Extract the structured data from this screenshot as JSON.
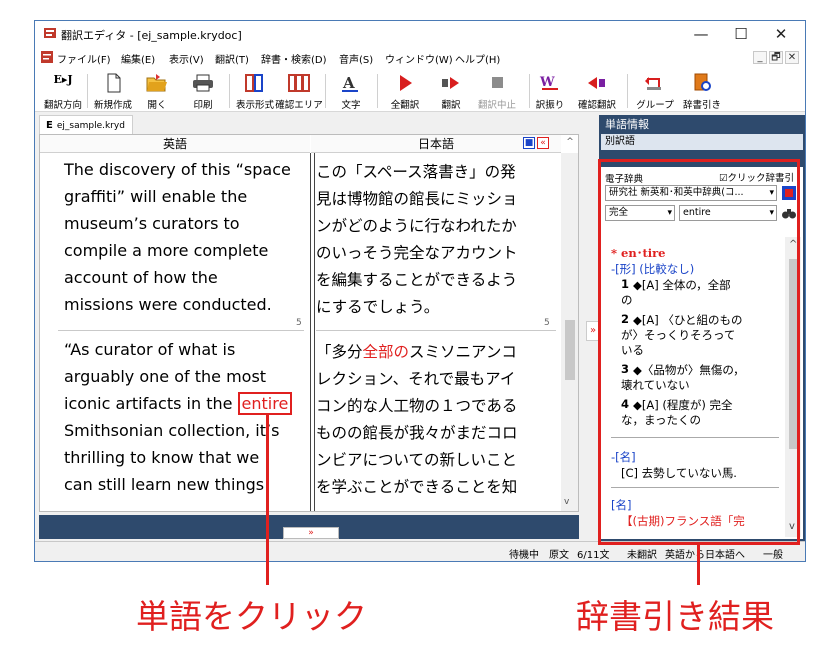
{
  "window": {
    "title": "翻訳エディタ - [ej_sample.krydoc]",
    "controls": {
      "minimize": "—",
      "maximize": "☐",
      "close": "✕"
    }
  },
  "menubar": {
    "items": [
      "ファイル(F)",
      "編集(E)",
      "表示(V)",
      "翻訳(T)",
      "辞書・検索(D)",
      "音声(S)",
      "ウィンドウ(W)",
      "ヘルプ(H)"
    ],
    "mdi": [
      "_",
      "🗗",
      "✕"
    ]
  },
  "toolbar": {
    "items": [
      {
        "label": "翻訳方向",
        "icon": "translation-direction-icon"
      },
      {
        "label": "新規作成",
        "icon": "new-document-icon"
      },
      {
        "label": "開く",
        "icon": "open-folder-icon"
      },
      {
        "label": "印刷",
        "icon": "printer-icon"
      },
      {
        "label": "表示形式",
        "icon": "display-format-icon"
      },
      {
        "label": "確認エリア",
        "icon": "check-area-icon"
      },
      {
        "label": "文字",
        "icon": "font-icon"
      },
      {
        "label": "全翻訳",
        "icon": "translate-all-icon"
      },
      {
        "label": "翻訳",
        "icon": "translate-icon"
      },
      {
        "label": "翻訳中止",
        "icon": "stop-icon"
      },
      {
        "label": "訳振り",
        "icon": "annotate-icon"
      },
      {
        "label": "確認翻訳",
        "icon": "back-translate-icon"
      },
      {
        "label": "グループ",
        "icon": "group-icon"
      },
      {
        "label": "辞書引き",
        "icon": "dictionary-lookup-icon"
      }
    ],
    "direction_text": "E▸J"
  },
  "doc_tab": {
    "prefix": "E",
    "name": "ej_sample.kryd"
  },
  "editor": {
    "header_english": "英語",
    "header_japanese": "日本語",
    "paragraphs": [
      {
        "number": "5",
        "english": [
          "The discovery of this “space",
          "graffiti” will enable the",
          "museum’s curators to",
          "compile a more complete",
          "account of how the",
          "missions were conducted."
        ],
        "japanese": [
          "この「スペース落書き」の発",
          "見は博物館の館長にミッショ",
          "ンがどのように行なわれたか",
          "のいっそう完全なアカウント",
          "を編集することができるよう",
          "にするでしょう。"
        ]
      },
      {
        "number": "5",
        "english": [
          "“As curator of what is",
          "arguably one of the most",
          "iconic artifacts in the ",
          "Smithsonian collection, it’s",
          "thrilling to know that we",
          "can still learn new things"
        ],
        "english_highlight": "entire",
        "japanese": [
          "「多分",
          "レクション、それで最もアイ",
          "コン的な人工物の１つである",
          "ものの館長が我々がまだコロ",
          "ンビアについての新しいこと",
          "を学ぶことができることを知"
        ],
        "japanese_highlight": "全部の",
        "japanese_first_tail": "スミソニアンコ"
      }
    ]
  },
  "statusbar": {
    "state": "待機中",
    "view": "原文",
    "position": "6/11文",
    "translated": "未翻訳",
    "direction": "英語から日本語へ",
    "mode": "一般"
  },
  "right_panel": {
    "title": "単語情報",
    "subtitle": "別訳語",
    "dictionary": {
      "title": "電子辞典",
      "click_lookup_label": "☑クリック辞書引",
      "dictionary_select": "研究社 新英和･和英中辞典(コ...",
      "match_select": "完全",
      "search_value": "entire",
      "entry": {
        "headword": "* en･tire",
        "pos1": "-[形] (比較なし)",
        "senses": [
          {
            "n": "1",
            "text": "◆[A] 全体の，全部",
            "cont": "の"
          },
          {
            "n": "2",
            "text": "◆[A] 〈ひと組のもの",
            "cont": "が〉そっくりそろって",
            "cont2": "いる"
          },
          {
            "n": "3",
            "text": "◆〈品物が〉無傷の，",
            "cont": "壊れていない"
          },
          {
            "n": "4",
            "text": "◆[A] (程度が) 完全",
            "cont": "な，まったくの"
          }
        ],
        "pos2": "-[名]",
        "pos2_text": "[C] 去勢していない馬.",
        "pos3": "[名]",
        "etym": "【(古期)フランス語「完"
      }
    }
  },
  "annotations": {
    "left_caption": "単語をクリック",
    "right_caption": "辞書引き結果"
  },
  "colors": {
    "accent_red": "#e0201f",
    "panel_navy": "#2e4a6d",
    "link_blue": "#1a44c8"
  }
}
